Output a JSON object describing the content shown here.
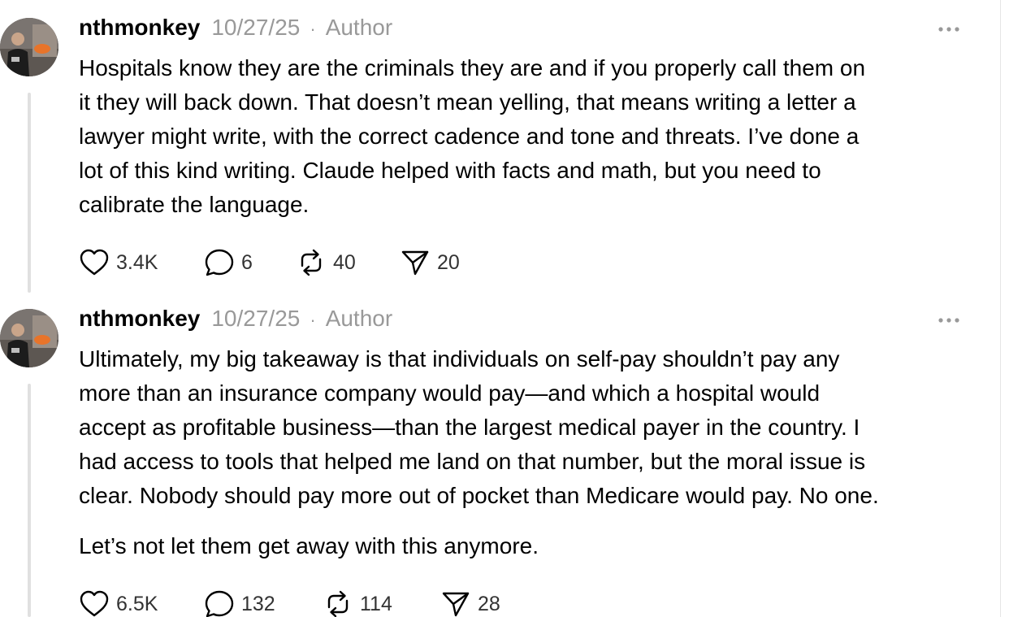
{
  "posts": [
    {
      "username": "nthmonkey",
      "timestamp": "10/27/25",
      "separator": "·",
      "role": "Author",
      "paragraphs": [
        "Hospitals know they are the criminals they are and if you properly call them on\nit they will back down. That doesn’t mean yelling, that means writing a letter a\nlawyer might write, with the correct cadence and tone and threats. I’ve done a\nlot of this kind writing. Claude helped with facts and math, but you need to\ncalibrate the language."
      ],
      "actions": {
        "likes": "3.4K",
        "replies": "6",
        "reposts": "40",
        "shares": "20"
      }
    },
    {
      "username": "nthmonkey",
      "timestamp": "10/27/25",
      "separator": "·",
      "role": "Author",
      "paragraphs": [
        "Ultimately, my big takeaway is that individuals on self-pay shouldn’t pay any\nmore than an insurance company would pay—and which a hospital would\naccept as profitable business—than the largest medical payer in the country. I\nhad access to tools that helped me land on that number, but the moral issue is\nclear. Nobody should pay more out of pocket than Medicare would pay. No one.",
        "Let’s not let them get away with this anymore."
      ],
      "actions": {
        "likes": "6.5K",
        "replies": "132",
        "reposts": "114",
        "shares": "28"
      }
    }
  ],
  "icons": {
    "like": "heart-icon",
    "reply": "comment-icon",
    "repost": "repost-icon",
    "share": "send-icon",
    "more": "more-dots-icon"
  }
}
